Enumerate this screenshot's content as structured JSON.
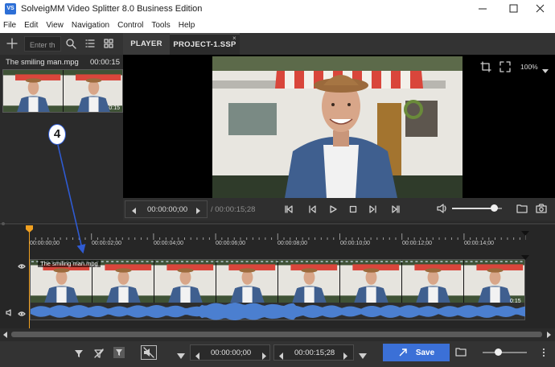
{
  "window": {
    "title": "SolveigMM Video Splitter 8.0 Business Edition",
    "icon_text": "VS"
  },
  "menu": [
    "File",
    "Edit",
    "View",
    "Navigation",
    "Control",
    "Tools",
    "Help"
  ],
  "toolbar": {
    "filter_placeholder": "Enter th"
  },
  "tabs": [
    {
      "label": "PLAYER"
    },
    {
      "label": "PROJECT-1.SSP"
    }
  ],
  "library": {
    "file_name": "The smiling man.mpg",
    "duration": "00:00:15",
    "thumb_time": "0:15"
  },
  "preview": {
    "zoom": "100%"
  },
  "transport": {
    "current_time": "00:00:00;00",
    "total_time": "/ 00:00:15;28",
    "volume": 0.85
  },
  "timeline": {
    "ticks": [
      "00:00:00;00",
      "00:00:02;00",
      "00:00:04;00",
      "00:00:06;00",
      "00:00:08;00",
      "00:00:10;00",
      "00:00:12;00",
      "00:00:14;00"
    ],
    "track_name": "The smiling man.mpg",
    "track_time": "0:15"
  },
  "bottom": {
    "start_time": "00:00:00;00",
    "end_time": "00:00:15;28",
    "save_label": "Save"
  },
  "annotation": {
    "label": "4"
  },
  "colors": {
    "accent": "#3b70d7",
    "playhead": "#f0a020",
    "waveform": "#4b7fd0",
    "callout": "#2f5bd3"
  }
}
